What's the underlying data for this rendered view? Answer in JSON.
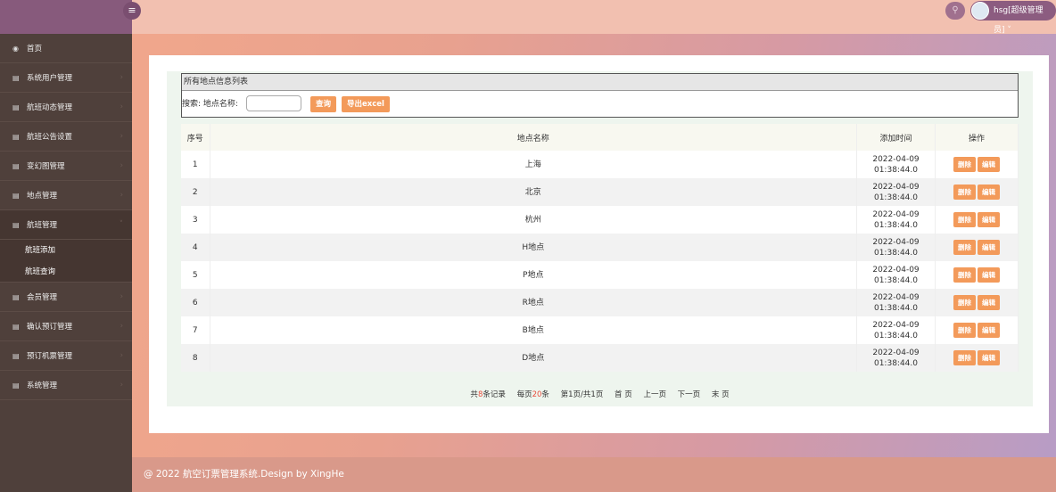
{
  "header": {
    "user": "hsg[超级管理员]",
    "toggle_icon": "menu-icon",
    "search_icon": "search-icon"
  },
  "sidebar": {
    "items": [
      {
        "label": "首页",
        "icon": "dashboard-icon"
      },
      {
        "label": "系统用户管理"
      },
      {
        "label": "航班动态管理"
      },
      {
        "label": "航班公告设置"
      },
      {
        "label": "变幻图管理"
      },
      {
        "label": "地点管理"
      },
      {
        "label": "航班管理",
        "open": true
      },
      {
        "label": "会员管理"
      },
      {
        "label": "确认预订管理"
      },
      {
        "label": "预订机票管理"
      },
      {
        "label": "系统管理"
      }
    ],
    "sub": [
      "航班添加",
      "航班查询"
    ]
  },
  "panel": {
    "title": "所有地点信息列表",
    "search_label": "搜索: 地点名称:",
    "search_value": "",
    "query_btn": "查询",
    "export_btn": "导出excel"
  },
  "table": {
    "headers": [
      "序号",
      "地点名称",
      "添加时间",
      "操作"
    ],
    "rows": [
      {
        "no": "1",
        "name": "上海",
        "date": "2022-04-09",
        "time": "01:38:44.0"
      },
      {
        "no": "2",
        "name": "北京",
        "date": "2022-04-09",
        "time": "01:38:44.0"
      },
      {
        "no": "3",
        "name": "杭州",
        "date": "2022-04-09",
        "time": "01:38:44.0"
      },
      {
        "no": "4",
        "name": "H地点",
        "date": "2022-04-09",
        "time": "01:38:44.0"
      },
      {
        "no": "5",
        "name": "P地点",
        "date": "2022-04-09",
        "time": "01:38:44.0"
      },
      {
        "no": "6",
        "name": "R地点",
        "date": "2022-04-09",
        "time": "01:38:44.0"
      },
      {
        "no": "7",
        "name": "B地点",
        "date": "2022-04-09",
        "time": "01:38:44.0"
      },
      {
        "no": "8",
        "name": "D地点",
        "date": "2022-04-09",
        "time": "01:38:44.0"
      }
    ],
    "delete": "删除",
    "edit": "编辑"
  },
  "pager": {
    "total_pre": "共",
    "total": "8",
    "total_post": "条记录",
    "per_pre": "每页",
    "per": "20",
    "per_post": "条",
    "page": "第1页/共1页",
    "first": "首 页",
    "prev": "上一页",
    "next": "下一页",
    "last": "末 页"
  },
  "footer": "@ 2022 航空订票管理系统.Design by XingHe"
}
